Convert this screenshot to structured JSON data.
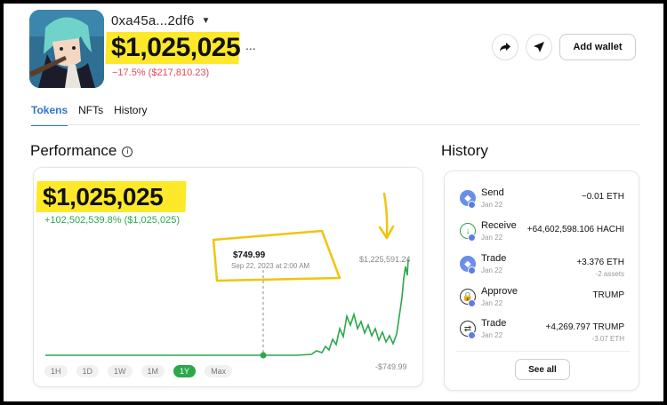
{
  "wallet": {
    "address": "0xa45a...2df6",
    "balance": "$1,025,025",
    "more": "...",
    "change": "−17.5% ($217,810.23)"
  },
  "actions": {
    "share_icon": "share-icon",
    "send_icon": "send-icon",
    "add_wallet_label": "Add wallet"
  },
  "tabs": [
    {
      "label": "Tokens",
      "active": true
    },
    {
      "label": "NFTs",
      "active": false
    },
    {
      "label": "History",
      "active": false
    }
  ],
  "performance": {
    "title": "Performance",
    "value": "$1,025,025",
    "change": "+102,502,539.8% ($1,025,025)",
    "tooltip_price": "$749.99",
    "tooltip_date": "Sep 22, 2023 at 2:00 AM",
    "max_label": "$1,225,591.24",
    "min_label": "-$749.99",
    "ranges": [
      {
        "label": "1H",
        "active": false
      },
      {
        "label": "1D",
        "active": false
      },
      {
        "label": "1W",
        "active": false
      },
      {
        "label": "1M",
        "active": false
      },
      {
        "label": "1Y",
        "active": true
      },
      {
        "label": "Max",
        "active": false
      }
    ],
    "colors": {
      "line": "#2aa84a",
      "highlight": "#fde829",
      "annotation": "#f1c40f"
    }
  },
  "history": {
    "title": "History",
    "see_all": "See all",
    "items": [
      {
        "type": "Send",
        "date": "Jan 22",
        "amount": "−0.01 ETH",
        "sub": "",
        "icon": "eth-icon"
      },
      {
        "type": "Receive",
        "date": "Jan 22",
        "amount": "+64,602,598.106 HACHI",
        "sub": "",
        "icon": "receive-icon"
      },
      {
        "type": "Trade",
        "date": "Jan 22",
        "amount": "+3.376 ETH",
        "sub": "-2 assets",
        "icon": "eth-icon"
      },
      {
        "type": "Approve",
        "date": "Jan 22",
        "amount": "TRUMP",
        "sub": "",
        "icon": "lock-icon"
      },
      {
        "type": "Trade",
        "date": "Jan 22",
        "amount": "+4,269.797 TRUMP",
        "sub": "-3.07 ETH",
        "icon": "swap-icon"
      }
    ]
  }
}
